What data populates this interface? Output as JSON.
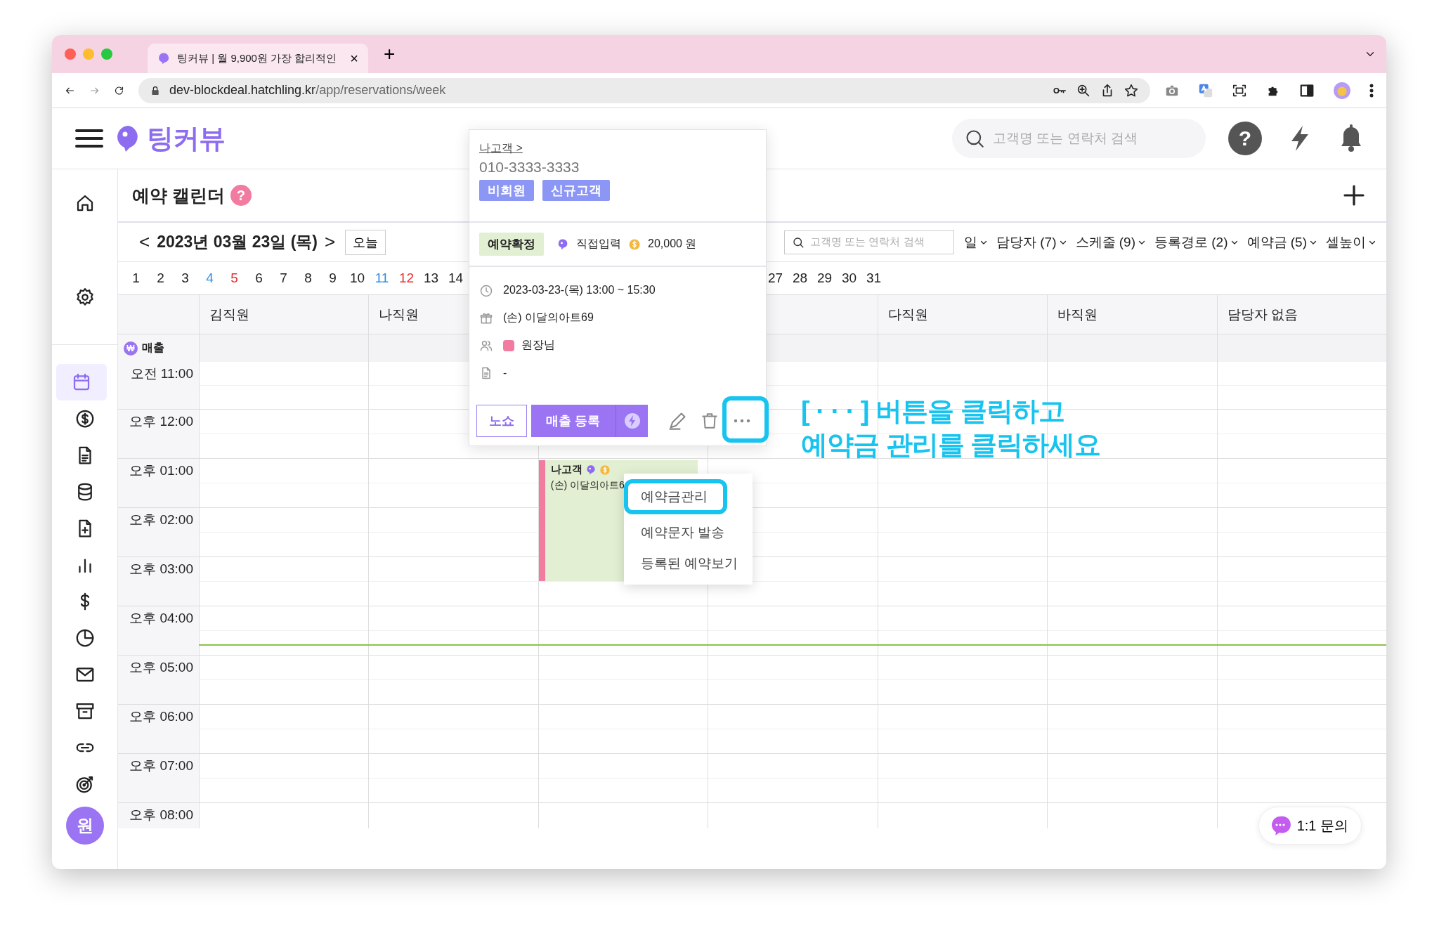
{
  "browser": {
    "tab_title": "팅커뷰 | 월 9,900원 가장 합리적인",
    "close": "×",
    "new_tab": "+",
    "url_host": "dev-blockdeal.hatchling.kr",
    "url_path": "/app/reservations/week"
  },
  "header": {
    "logo": "팅커뷰",
    "search_placeholder": "고객명 또는 연락처 검색",
    "help": "?"
  },
  "sidebar": {
    "items": [
      {
        "selected": false
      },
      {
        "selected": false
      },
      {
        "selected": true
      },
      {
        "selected": false
      },
      {
        "selected": false
      },
      {
        "selected": false
      },
      {
        "selected": false
      },
      {
        "selected": false
      },
      {
        "selected": false
      },
      {
        "selected": false
      },
      {
        "selected": false
      },
      {
        "selected": false
      },
      {
        "selected": false
      },
      {
        "selected": false
      }
    ],
    "avatar": "원"
  },
  "page": {
    "title": "예약 캘린더",
    "help": "?"
  },
  "date_nav": {
    "prev": "<",
    "date": "2023년 03월 23일 (목)",
    "next": ">",
    "today": "오늘"
  },
  "filters": {
    "search_placeholder": "고객명 또는 연락처 검색",
    "dropdowns": [
      {
        "label": "일"
      },
      {
        "label": "담당자 (7)"
      },
      {
        "label": "스케줄 (9)"
      },
      {
        "label": "등록경로 (2)"
      },
      {
        "label": "예약금 (5)"
      },
      {
        "label": "셀높이"
      }
    ]
  },
  "days": {
    "before": [
      {
        "label": "1",
        "color": "#222222"
      },
      {
        "label": "2",
        "color": "#222222"
      },
      {
        "label": "3",
        "color": "#222222"
      },
      {
        "label": "4",
        "color": "#2f8fe6"
      },
      {
        "label": "5",
        "color": "#e03131"
      },
      {
        "label": "6",
        "color": "#222222"
      },
      {
        "label": "7",
        "color": "#222222"
      },
      {
        "label": "8",
        "color": "#222222"
      },
      {
        "label": "9",
        "color": "#222222"
      },
      {
        "label": "10",
        "color": "#222222"
      },
      {
        "label": "11",
        "color": "#2f8fe6"
      },
      {
        "label": "12",
        "color": "#e03131"
      },
      {
        "label": "13",
        "color": "#222222"
      },
      {
        "label": "14",
        "color": "#222222"
      }
    ],
    "after": [
      {
        "label": "27",
        "color": "#222222"
      },
      {
        "label": "28",
        "color": "#222222"
      },
      {
        "label": "29",
        "color": "#222222"
      },
      {
        "label": "30",
        "color": "#222222"
      },
      {
        "label": "31",
        "color": "#222222"
      }
    ]
  },
  "grid": {
    "sales_icon": "₩",
    "sales_label": "매출",
    "times": [
      "오전 11:00",
      "오후 12:00",
      "오후 01:00",
      "오후 02:00",
      "오후 03:00",
      "오후 04:00",
      "오후 05:00",
      "오후 06:00",
      "오후 07:00",
      "오후 08:00"
    ],
    "columns": [
      {
        "name": "김직원"
      },
      {
        "name": "나직원"
      },
      {
        "events": [
          {
            "title": "나고객",
            "text": "(손) 이달의아트6",
            "color": "#f27ba0"
          }
        ]
      },
      {},
      {
        "name": "다직원"
      },
      {
        "name": "바직원"
      },
      {
        "name": "담당자 없음"
      }
    ]
  },
  "popup": {
    "customer": "나고객 >",
    "phone": "010-3333-3333",
    "tags": [
      "비회원",
      "신규고객"
    ],
    "status": "예약확정",
    "source": "직접입력",
    "deposit": "20,000 원",
    "details": [
      {
        "kind": "time",
        "text": "2023-03-23-(목) 13:00 ~ 15:30"
      },
      {
        "kind": "product",
        "text": "(손) 이달의아트69"
      },
      {
        "kind": "staff",
        "text": "원장님",
        "color": "#f27ba0"
      },
      {
        "kind": "memo",
        "text": "-"
      }
    ],
    "noshow": "노쇼",
    "register": "매출 등록",
    "more_highlighted": true
  },
  "menu": {
    "items": [
      {
        "label": "예약금관리",
        "highlighted": true
      },
      {
        "label": "예약문자 발송",
        "highlighted": false
      },
      {
        "label": "등록된 예약보기",
        "highlighted": false
      }
    ]
  },
  "annotation": "[ · · · ] 버튼을 클릭하고\n예약금 관리를 클릭하세요",
  "chat_button": "1:1 문의"
}
